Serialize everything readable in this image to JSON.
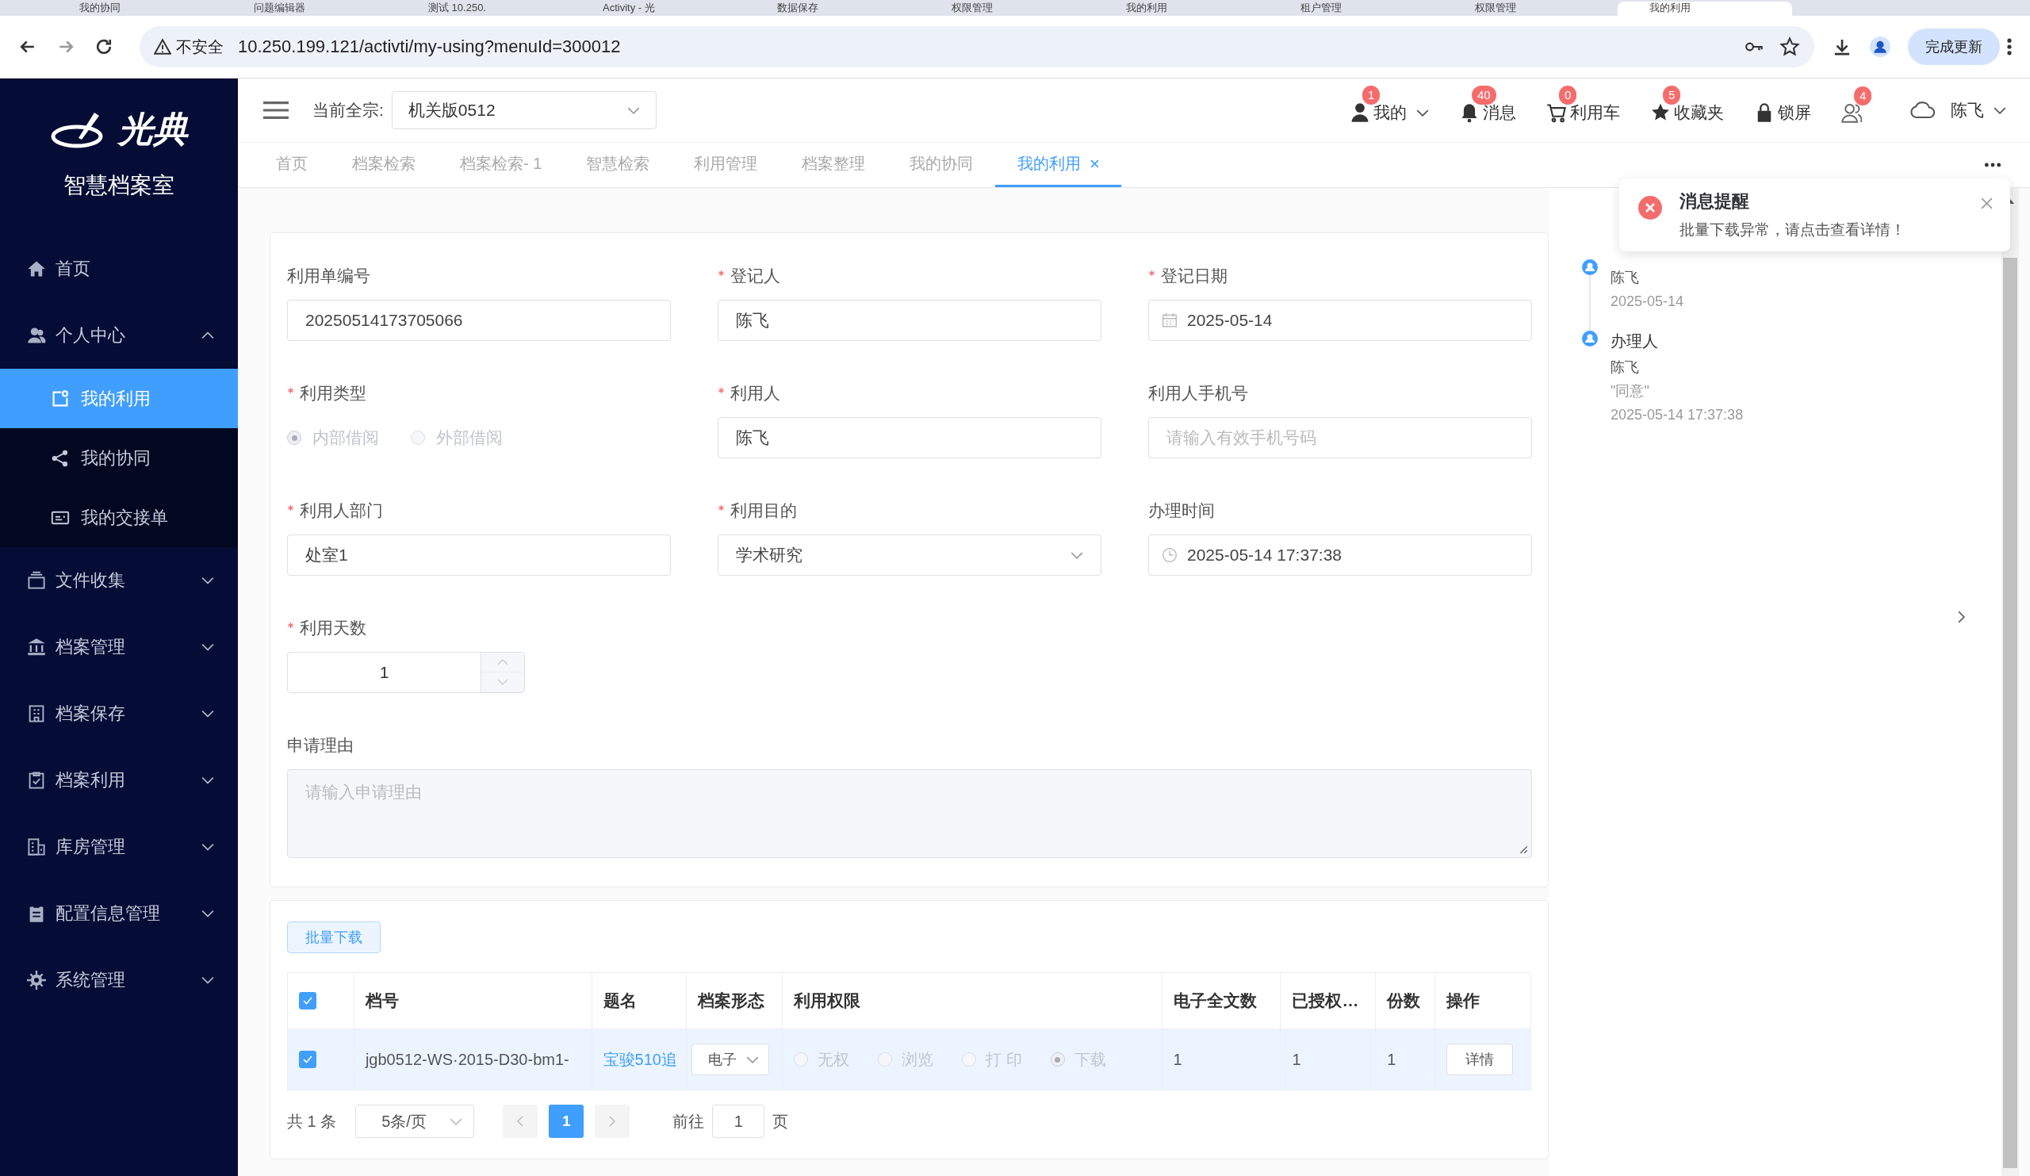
{
  "browser": {
    "tabs": [
      {
        "title": "我的协同",
        "selected": false
      },
      {
        "title": "问题编辑器",
        "selected": false
      },
      {
        "title": "测试 10.250.",
        "selected": false
      },
      {
        "title": "Activity - 光",
        "selected": false
      },
      {
        "title": "数据保存",
        "selected": false
      },
      {
        "title": "权限管理",
        "selected": false
      },
      {
        "title": "我的利用",
        "selected": false
      },
      {
        "title": "租户管理",
        "selected": false
      },
      {
        "title": "权限管理",
        "selected": false
      },
      {
        "title": "我的利用",
        "selected": true
      }
    ],
    "security": "不安全",
    "url": "10.250.199.121/activti/my-using?menuId=300012",
    "update_button": "完成更新"
  },
  "sidebar": {
    "logo": "光典",
    "title": "智慧档案室",
    "items": [
      {
        "label": "首页",
        "kind": "link",
        "selected": false
      },
      {
        "label": "个人中心",
        "kind": "group",
        "expanded": true,
        "selected": false,
        "children": [
          {
            "label": "我的利用",
            "selected": true
          },
          {
            "label": "我的协同",
            "selected": false
          },
          {
            "label": "我的交接单",
            "selected": false
          }
        ]
      },
      {
        "label": "文件收集",
        "kind": "group",
        "expanded": false,
        "selected": false
      },
      {
        "label": "档案管理",
        "kind": "group",
        "expanded": false,
        "selected": false
      },
      {
        "label": "档案保存",
        "kind": "group",
        "expanded": false,
        "selected": false
      },
      {
        "label": "档案利用",
        "kind": "group",
        "expanded": false,
        "selected": false
      },
      {
        "label": "库房管理",
        "kind": "group",
        "expanded": false,
        "selected": false
      },
      {
        "label": "配置信息管理",
        "kind": "group",
        "expanded": false,
        "selected": false
      },
      {
        "label": "系统管理",
        "kind": "group",
        "expanded": false,
        "selected": false
      }
    ]
  },
  "header": {
    "fonds_label": "当前全宗:",
    "fonds_value": "机关版0512",
    "items": [
      {
        "label": "我的",
        "badge": "1",
        "dropdown": true
      },
      {
        "label": "消息",
        "badge": "40",
        "dropdown": false
      },
      {
        "label": "利用车",
        "badge": "0",
        "dropdown": false
      },
      {
        "label": "收藏夹",
        "badge": "5",
        "dropdown": false
      },
      {
        "label": "锁屏",
        "dropdown": false
      },
      {
        "badge": "4",
        "dropdown": false
      }
    ],
    "user": "陈飞"
  },
  "tabs": [
    {
      "label": "首页",
      "selected": false
    },
    {
      "label": "档案检索",
      "selected": false
    },
    {
      "label": "档案检索- 1",
      "selected": false
    },
    {
      "label": "智慧检索",
      "selected": false
    },
    {
      "label": "利用管理",
      "selected": false
    },
    {
      "label": "档案整理",
      "selected": false
    },
    {
      "label": "我的协同",
      "selected": false
    },
    {
      "label": "我的利用",
      "selected": true
    }
  ],
  "form": {
    "fields": [
      {
        "label": "利用单编号",
        "required": false,
        "kind": "input",
        "value": "20250514173705066"
      },
      {
        "label": "登记人",
        "required": true,
        "kind": "input",
        "value": "陈飞"
      },
      {
        "label": "登记日期",
        "required": true,
        "kind": "date",
        "value": "2025-05-14"
      },
      {
        "label": "利用类型",
        "required": true,
        "kind": "radio",
        "options": [
          {
            "label": "内部借阅",
            "selected": true
          },
          {
            "label": "外部借阅",
            "selected": false
          }
        ]
      },
      {
        "label": "利用人",
        "required": true,
        "kind": "input",
        "value": "陈飞"
      },
      {
        "label": "利用人手机号",
        "required": false,
        "kind": "input",
        "placeholder": "请输入有效手机号码"
      },
      {
        "label": "利用人部门",
        "required": true,
        "kind": "input",
        "value": "处室1"
      },
      {
        "label": "利用目的",
        "required": true,
        "kind": "select",
        "value": "学术研究"
      },
      {
        "label": "办理时间",
        "required": false,
        "kind": "time",
        "value": "2025-05-14 17:37:38"
      },
      {
        "label": "利用天数",
        "required": true,
        "kind": "number",
        "value": "1"
      },
      {
        "label": "申请理由",
        "required": false,
        "kind": "textarea",
        "placeholder": "请输入申请理由"
      }
    ]
  },
  "table": {
    "batch_button": "批量下载",
    "all_checked": true,
    "columns": [
      "档号",
      "题名",
      "档案形态",
      "利用权限",
      "电子全文数",
      "已授权…",
      "份数",
      "操作"
    ],
    "rows": [
      {
        "checked": true,
        "archive_no": "jgb0512-WS·2015-D30-bm1-",
        "title": "宝骏510追",
        "form": "电子",
        "permissions": [
          {
            "label": "无权",
            "selected": false
          },
          {
            "label": "浏览",
            "selected": false
          },
          {
            "label": "打 印",
            "selected": false
          },
          {
            "label": "下载",
            "selected": true
          }
        ],
        "fulltext_count": "1",
        "authorized": "1",
        "copies": "1",
        "action": "详情"
      }
    ],
    "pagination": {
      "total": "共 1 条",
      "page_size": "5条/页",
      "pages": [
        {
          "label": "1",
          "selected": true
        }
      ],
      "goto_label": "前往",
      "goto_value": "1",
      "goto_suffix": "页"
    }
  },
  "timeline": [
    {
      "lines": [
        "陈飞",
        "2025-05-14"
      ]
    },
    {
      "title": "办理人",
      "lines": [
        "陈飞",
        "\"同意\"",
        "2025-05-14 17:37:38"
      ]
    }
  ],
  "notification": {
    "title": "消息提醒",
    "message": "批量下载异常，请点击查看详情！"
  }
}
